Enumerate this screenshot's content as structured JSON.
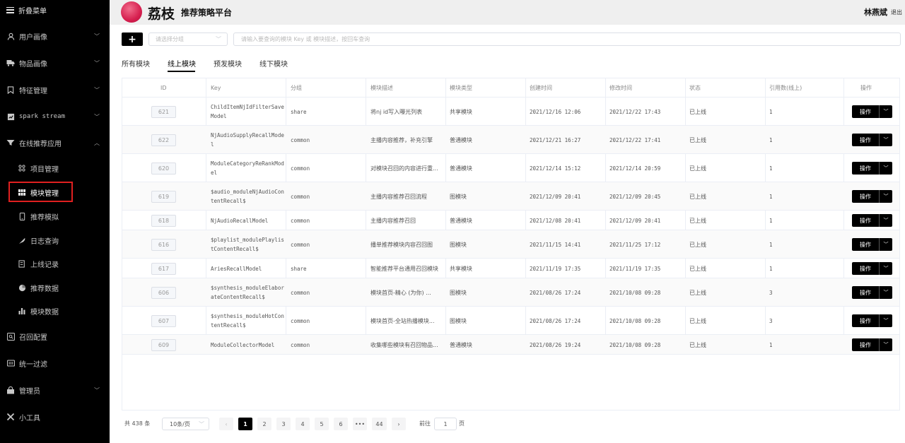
{
  "sidebar": {
    "collapse_label": "折叠菜单",
    "items": [
      {
        "label": "用户画像",
        "icon": "user-icon"
      },
      {
        "label": "物品画像",
        "icon": "truck-icon"
      },
      {
        "label": "特征管理",
        "icon": "bookmark-icon"
      },
      {
        "label": "spark stream",
        "icon": "chart-check-icon"
      },
      {
        "label": "在线推荐应用",
        "icon": "filter-icon"
      },
      {
        "label": "项目管理",
        "icon": "dots-grid-icon"
      },
      {
        "label": "模块管理",
        "icon": "grid-icon"
      },
      {
        "label": "推荐模拟",
        "icon": "phone-icon"
      },
      {
        "label": "日志查询",
        "icon": "feather-icon"
      },
      {
        "label": "上线记录",
        "icon": "edit-doc-icon"
      },
      {
        "label": "推荐数据",
        "icon": "pie-icon"
      },
      {
        "label": "模块数据",
        "icon": "bar-chart-icon"
      },
      {
        "label": "召回配置",
        "icon": "search-box-icon"
      },
      {
        "label": "统一过滤",
        "icon": "film-icon"
      },
      {
        "label": "管理员",
        "icon": "admin-icon"
      },
      {
        "label": "小工具",
        "icon": "tools-icon"
      }
    ]
  },
  "header": {
    "logo_text": "荔枝",
    "subtitle": "推荐策略平台",
    "user_name": "林燕斌",
    "logout_label": "退出"
  },
  "toolbar": {
    "add_label": "+",
    "group_placeholder": "请选择分组",
    "search_placeholder": "请输入要查询的模块 Key 或 模块描述，按回车查询"
  },
  "tabs": [
    "所有模块",
    "线上模块",
    "预发模块",
    "线下模块"
  ],
  "table": {
    "columns": [
      "ID",
      "Key",
      "分组",
      "模块描述",
      "模块类型",
      "创建时间",
      "修改时间",
      "状态",
      "引用数(线上)",
      "操作"
    ],
    "action_label": "操作",
    "rows": [
      {
        "id": "621",
        "key": "ChildItemNjIdFilterSaveModel",
        "group": "share",
        "desc": "将nj id写入曝光列表",
        "type": "共享模块",
        "created": "2021/12/16 12:06",
        "modified": "2021/12/22 17:43",
        "status": "已上线",
        "refs": "1"
      },
      {
        "id": "622",
        "key": "NjAudioSupplyRecallModel",
        "group": "common",
        "desc": "主播内容推荐，补充引擎",
        "type": "普通模块",
        "created": "2021/12/21 16:27",
        "modified": "2021/12/22 17:41",
        "status": "已上线",
        "refs": "1"
      },
      {
        "id": "620",
        "key": "ModuleCategoryReRankModel",
        "group": "common",
        "desc": "对模块召回的内容进行重...",
        "type": "普通模块",
        "created": "2021/12/14 15:12",
        "modified": "2021/12/14 20:59",
        "status": "已上线",
        "refs": "1"
      },
      {
        "id": "619",
        "key": "$audio_moduleNjAudioContentRecall$",
        "group": "common",
        "desc": "主播内容推荐召回流程",
        "type": "图模块",
        "created": "2021/12/09 20:41",
        "modified": "2021/12/09 20:45",
        "status": "已上线",
        "refs": "1"
      },
      {
        "id": "618",
        "key": "NjAudioRecallModel",
        "group": "common",
        "desc": "主播内容推荐召回",
        "type": "普通模块",
        "created": "2021/12/08 20:41",
        "modified": "2021/12/09 20:41",
        "status": "已上线",
        "refs": "1"
      },
      {
        "id": "616",
        "key": "$playlist_modulePlaylistContentRecall$",
        "group": "common",
        "desc": "播单推荐模块内容召回图",
        "type": "图模块",
        "created": "2021/11/15 14:41",
        "modified": "2021/11/25 17:12",
        "status": "已上线",
        "refs": "1"
      },
      {
        "id": "617",
        "key": "AriesRecallModel",
        "group": "share",
        "desc": "智能推荐平台通用召回模块",
        "type": "共享模块",
        "created": "2021/11/19 17:35",
        "modified": "2021/11/19 17:35",
        "status": "已上线",
        "refs": "1"
      },
      {
        "id": "606",
        "key": "$synthesis_moduleElaborateContentRecall$",
        "group": "common",
        "desc": "模块首页-精心 (为你) ...",
        "type": "图模块",
        "created": "2021/08/26 17:24",
        "modified": "2021/10/08 09:28",
        "status": "已上线",
        "refs": "3"
      },
      {
        "id": "607",
        "key": "$synthesis_moduleHotContentRecall$",
        "group": "common",
        "desc": "模块首页-全站热播模块...",
        "type": "图模块",
        "created": "2021/08/26 17:24",
        "modified": "2021/10/08 09:28",
        "status": "已上线",
        "refs": "3"
      },
      {
        "id": "609",
        "key": "ModuleCollectorModel",
        "group": "common",
        "desc": "收集哪些模块有召回物品...",
        "type": "普通模块",
        "created": "2021/08/26 19:24",
        "modified": "2021/10/08 09:28",
        "status": "已上线",
        "refs": "1"
      }
    ]
  },
  "pagination": {
    "total_label": "共 438 条",
    "page_size": "10条/页",
    "pages": [
      "1",
      "2",
      "3",
      "4",
      "5",
      "6",
      "•••",
      "44"
    ],
    "prev": "‹",
    "next": "›",
    "goto_label": "前往",
    "goto_value": "1",
    "page_suffix": "页"
  }
}
